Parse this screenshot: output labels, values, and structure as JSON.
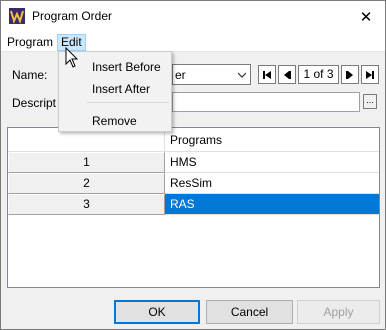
{
  "window": {
    "title": "Program Order",
    "close_glyph": "✕"
  },
  "menubar": {
    "program": "Program",
    "edit": "Edit"
  },
  "edit_menu": {
    "insert_before": "Insert Before",
    "insert_after": "Insert After",
    "remove": "Remove"
  },
  "form": {
    "name_label": "Name:",
    "name_value": "er",
    "record_position": "1 of 3",
    "description_label": "Descript",
    "description_value": "",
    "description_button": "..."
  },
  "table": {
    "columns": [
      "",
      "Programs"
    ],
    "rows": [
      {
        "num": "1",
        "program": "HMS"
      },
      {
        "num": "2",
        "program": "ResSim"
      },
      {
        "num": "3",
        "program": "RAS"
      }
    ],
    "selected_row": 3
  },
  "buttons": {
    "ok": "OK",
    "cancel": "Cancel",
    "apply": "Apply"
  },
  "colors": {
    "selection": "#0078d7",
    "menu_highlight": "#cce8ff"
  }
}
